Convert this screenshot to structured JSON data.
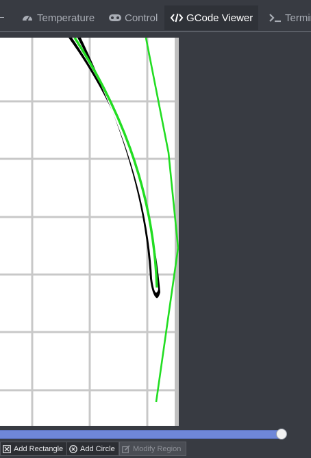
{
  "tabs": [
    {
      "label": "Temperature",
      "icon": "gauge-icon"
    },
    {
      "label": "Control",
      "icon": "gamepad-icon"
    },
    {
      "label": "GCode Viewer",
      "icon": "code-icon",
      "active": true
    },
    {
      "label": "Terminal",
      "icon": "terminal-icon"
    }
  ],
  "viewer": {
    "toolpath_color": "#22dd22",
    "grid_color": "#c8c8c8"
  },
  "layer_slider": {
    "value_fraction": 1.0
  },
  "toolbar": {
    "add_rectangle": "Add Rectangle",
    "add_circle": "Add Circle",
    "modify_region": "Modify Region"
  }
}
